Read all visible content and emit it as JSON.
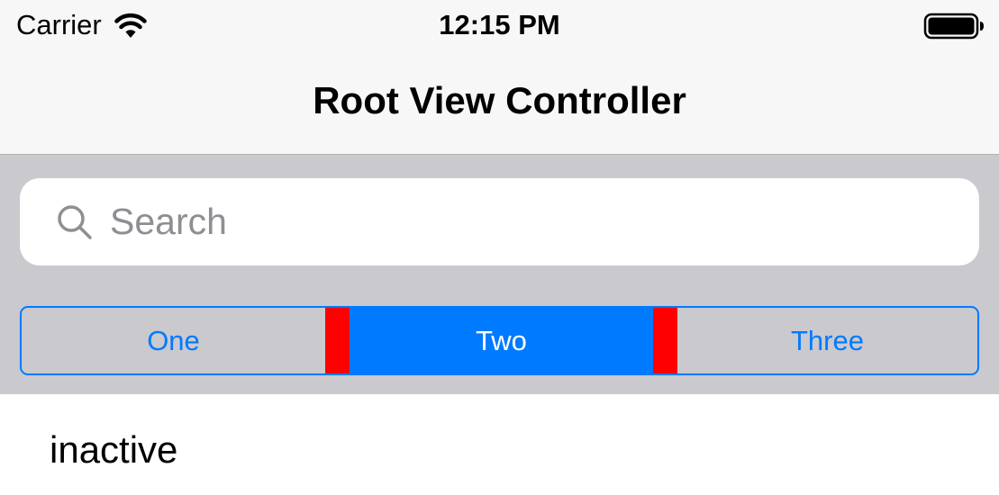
{
  "status_bar": {
    "carrier": "Carrier",
    "time": "12:15 PM",
    "wifi_icon": "wifi-icon",
    "battery_icon": "battery-full-icon"
  },
  "nav_bar": {
    "title": "Root View Controller"
  },
  "search": {
    "placeholder": "Search",
    "value": "",
    "icon": "search-icon"
  },
  "segmented_control": {
    "segments": [
      {
        "label": "One",
        "selected": false
      },
      {
        "label": "Two",
        "selected": true
      },
      {
        "label": "Three",
        "selected": false
      }
    ],
    "divider_color": "#ff0000",
    "tint_color": "#007aff"
  },
  "content": {
    "label": "inactive"
  },
  "colors": {
    "bar_background": "#f7f7f7",
    "search_area_background": "#c9c9ce",
    "placeholder_color": "#8e8e93"
  }
}
